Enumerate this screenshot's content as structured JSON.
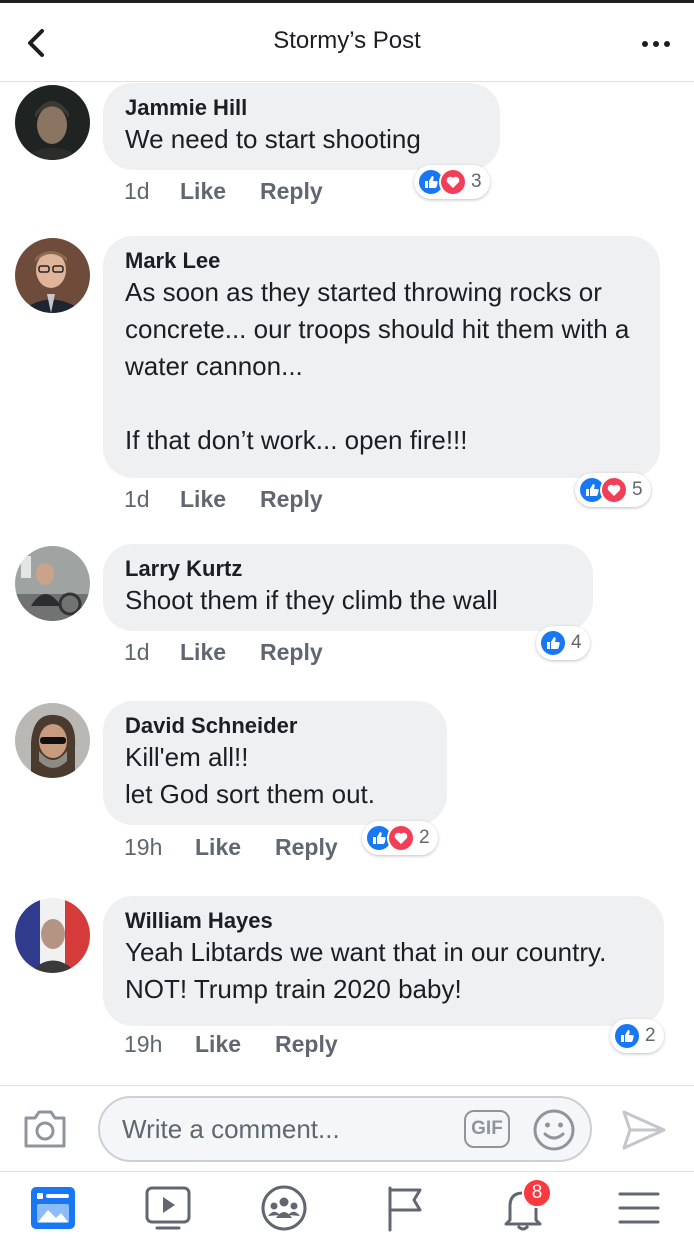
{
  "header": {
    "title": "Stormy’s Post",
    "back_icon": "chevron-left-icon",
    "more_icon": "more-dots-icon"
  },
  "actions": {
    "like": "Like",
    "reply": "Reply"
  },
  "colors": {
    "like_blue": "#1877f2",
    "love_red": "#f33e58",
    "bubble_gray": "#eff0f2",
    "badge_red": "#fa383e"
  },
  "comments": [
    {
      "author": "Jammie Hill",
      "text": "We need to start shooting",
      "time": "1d",
      "reactions": [
        "like",
        "love"
      ],
      "count": "3"
    },
    {
      "author": "Mark Lee",
      "text": "As soon as they started throwing rocks or concrete... our troops should hit them with a water cannon...\n\nIf that don’t work... open fire!!!",
      "time": "1d",
      "reactions": [
        "like",
        "love"
      ],
      "count": "5"
    },
    {
      "author": "Larry Kurtz",
      "text": "Shoot them if they climb the wall",
      "time": "1d",
      "reactions": [
        "like"
      ],
      "count": "4"
    },
    {
      "author": "David Schneider",
      "text": "Kill'em all!!\nlet God sort them out.",
      "time": "19h",
      "reactions": [
        "like",
        "love"
      ],
      "count": "2"
    },
    {
      "author": "William Hayes",
      "text": "Yeah Libtards we want that in our country. NOT! Trump train 2020 baby!",
      "time": "19h",
      "reactions": [
        "like"
      ],
      "count": "2"
    }
  ],
  "composer": {
    "placeholder": "Write a comment...",
    "gif_label": "GIF",
    "camera_icon": "camera-icon",
    "emoji_icon": "smiley-icon",
    "send_icon": "send-icon"
  },
  "tabbar": {
    "items": [
      {
        "name": "news-feed",
        "icon": "news-feed-icon",
        "active": true
      },
      {
        "name": "watch",
        "icon": "video-play-icon"
      },
      {
        "name": "groups",
        "icon": "groups-icon"
      },
      {
        "name": "pages",
        "icon": "flag-icon"
      },
      {
        "name": "notifications",
        "icon": "bell-icon",
        "badge": "8"
      },
      {
        "name": "menu",
        "icon": "hamburger-menu-icon"
      }
    ]
  }
}
